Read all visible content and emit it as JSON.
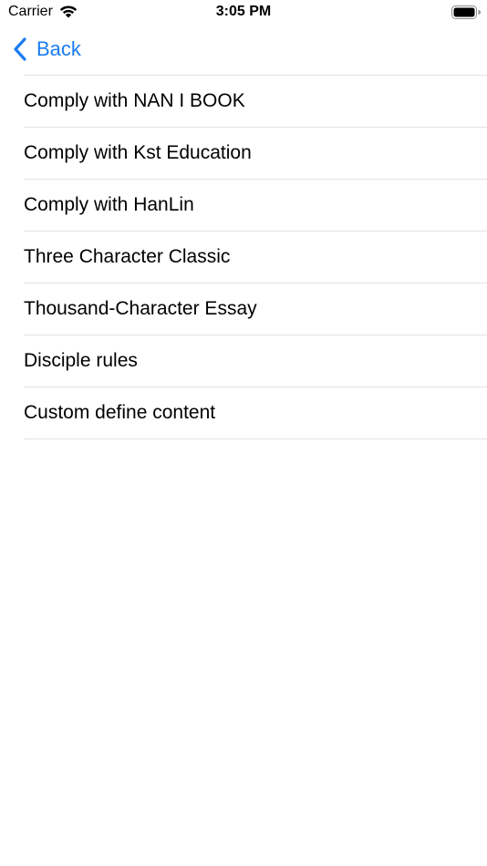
{
  "status_bar": {
    "carrier": "Carrier",
    "time": "3:05 PM",
    "wifi_icon": "wifi-icon",
    "battery_icon": "battery-icon"
  },
  "nav": {
    "back_label": "Back",
    "back_icon": "chevron-left-icon",
    "accent_color": "#1a7cf0"
  },
  "list": {
    "items": [
      {
        "label": "Comply with NAN I BOOK"
      },
      {
        "label": "Comply with Kst Education"
      },
      {
        "label": "Comply with HanLin"
      },
      {
        "label": "Three Character Classic"
      },
      {
        "label": "Thousand-Character Essay"
      },
      {
        "label": "Disciple rules"
      },
      {
        "label": "Custom define content"
      }
    ],
    "separator_color": "#e3e3e6"
  }
}
